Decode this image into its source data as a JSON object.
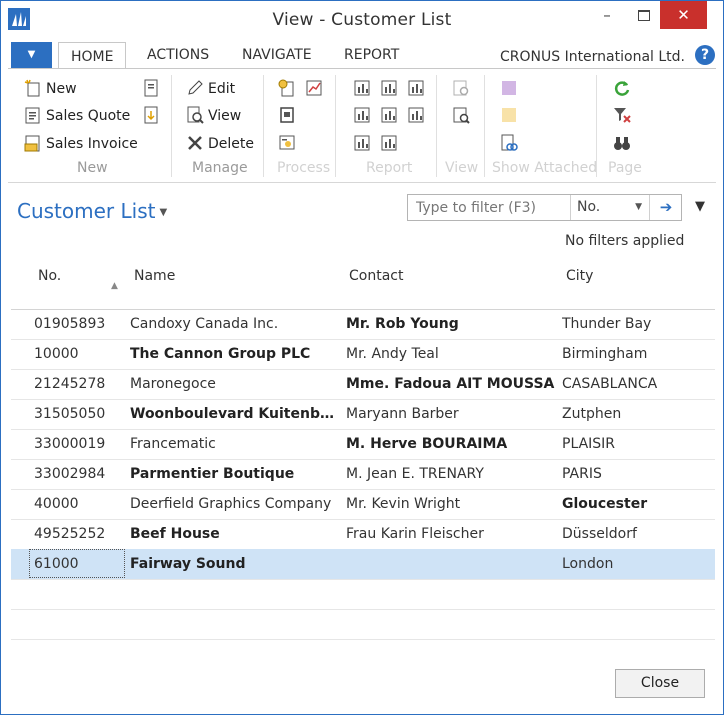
{
  "window": {
    "title": "View - Customer List",
    "minimize": "–",
    "close": "✕"
  },
  "tabs": {
    "app_menu": "▼",
    "items": [
      "HOME",
      "ACTIONS",
      "NAVIGATE",
      "REPORT"
    ],
    "company": "CRONUS International Ltd.",
    "help": "?"
  },
  "ribbon": {
    "new_group": {
      "new": "New",
      "sales_quote": "Sales Quote",
      "sales_invoice": "Sales Invoice",
      "label": "New"
    },
    "manage_group": {
      "edit": "Edit",
      "view": "View",
      "delete": "Delete",
      "label": "Manage"
    },
    "process_label": "Process",
    "report_label": "Report",
    "view_label": "View",
    "show_attached_label": "Show Attached",
    "page_label": "Page"
  },
  "page": {
    "title": "Customer List",
    "filter_placeholder": "Type to filter (F3)",
    "filter_field": "No.",
    "no_filters": "No filters applied"
  },
  "table": {
    "columns": [
      "No.",
      "Name",
      "Contact",
      "City"
    ],
    "rows": [
      {
        "no": "01905893",
        "name": "Candoxy Canada Inc.",
        "contact": "Mr. Rob Young",
        "city": "Thunder Bay"
      },
      {
        "no": "10000",
        "name": "The Cannon Group PLC",
        "contact": "Mr. Andy Teal",
        "city": "Birmingham"
      },
      {
        "no": "21245278",
        "name": "Maronegoce",
        "contact": "Mme. Fadoua AIT MOUSSA",
        "city": "CASABLANCA"
      },
      {
        "no": "31505050",
        "name": "Woonboulevard Kuitenbrou...",
        "contact": "Maryann Barber",
        "city": "Zutphen"
      },
      {
        "no": "33000019",
        "name": "Francematic",
        "contact": "M. Herve BOURAIMA",
        "city": "PLAISIR"
      },
      {
        "no": "33002984",
        "name": "Parmentier Boutique",
        "contact": "M. Jean E. TRENARY",
        "city": "PARIS"
      },
      {
        "no": "40000",
        "name": "Deerfield Graphics Company",
        "contact": "Mr. Kevin Wright",
        "city": "Gloucester"
      },
      {
        "no": "49525252",
        "name": "Beef House",
        "contact": "Frau Karin Fleischer",
        "city": "Düsseldorf"
      },
      {
        "no": "61000",
        "name": "Fairway Sound",
        "contact": "",
        "city": "London"
      }
    ]
  },
  "footer": {
    "close": "Close"
  },
  "colors": {
    "accent": "#2c6fc1",
    "selected_row": "#cfe3f6",
    "close_red": "#c9302c"
  },
  "icons": [
    "nav-logo-icon",
    "new-icon",
    "sales-quote-icon",
    "sales-invoice-icon",
    "edit-icon",
    "view-icon",
    "delete-icon",
    "refresh-icon",
    "clear-filter-icon",
    "find-icon"
  ]
}
